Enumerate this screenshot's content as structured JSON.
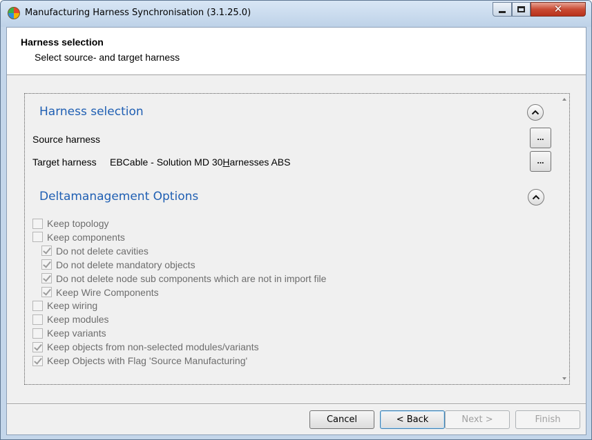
{
  "window": {
    "title": "Manufacturing Harness Synchronisation (3.1.25.0)",
    "close_glyph": "✕"
  },
  "header": {
    "title": "Harness selection",
    "subtitle": "Select source- and target harness"
  },
  "harness_section": {
    "title": "Harness selection",
    "source_label": "Source harness",
    "source_value": "",
    "target_label": "Target harness",
    "target_value_pre": "EBCable - Solution MD 30",
    "target_value_mnemonic": "H",
    "target_value_post": "arnesses ABS",
    "browse_label": "..."
  },
  "delta_section": {
    "title": "Deltamanagement Options",
    "options": [
      {
        "label": "Keep topology",
        "checked": false
      },
      {
        "label": "Keep components",
        "checked": false
      },
      {
        "label": "Do not delete cavities",
        "checked": true
      },
      {
        "label": "Do not delete mandatory objects",
        "checked": true
      },
      {
        "label": "Do not delete node sub components which are not in import file",
        "checked": true
      },
      {
        "label": "Keep Wire Components",
        "checked": true
      },
      {
        "label": "Keep wiring",
        "checked": false
      },
      {
        "label": "Keep modules",
        "checked": false
      },
      {
        "label": "Keep variants",
        "checked": false
      },
      {
        "label": "Keep objects from non-selected modules/variants",
        "checked": true
      },
      {
        "label": "Keep Objects with Flag 'Source Manufacturing'",
        "checked": true
      }
    ]
  },
  "buttons": {
    "cancel": "Cancel",
    "back": "< Back",
    "next": "Next >",
    "finish": "Finish"
  },
  "icons": {
    "app": "app-logo-icon",
    "minimize": "minimize-icon",
    "maximize": "maximize-icon",
    "close": "close-icon",
    "collapse": "chevron-up-icon"
  },
  "colors": {
    "section_title": "#1f5fb3",
    "close_button": "#c94b34"
  }
}
